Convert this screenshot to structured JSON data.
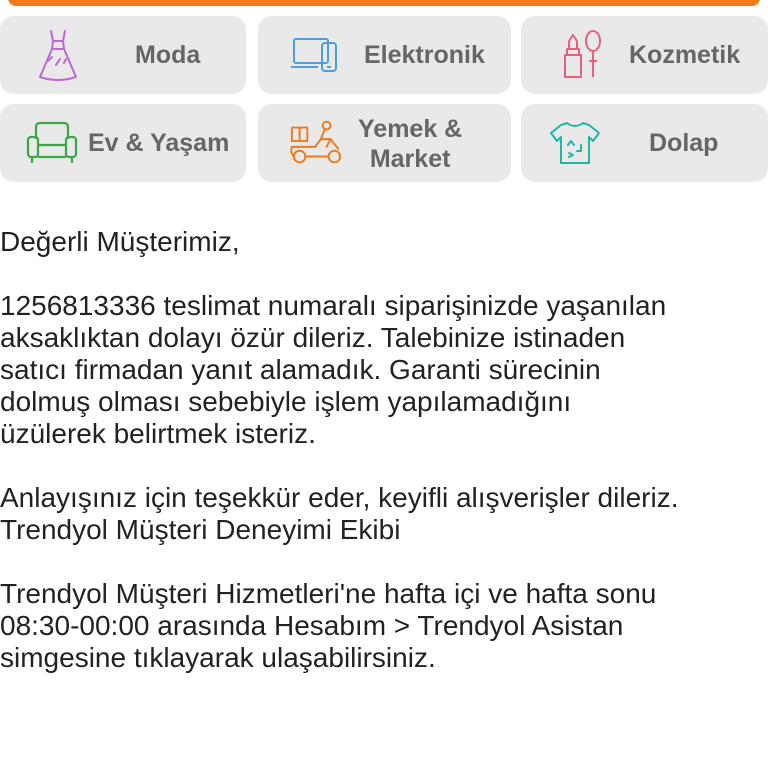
{
  "colors": {
    "accent": "#f27a1a",
    "tile_bg": "#e9e9e9",
    "label": "#666666"
  },
  "categories": [
    {
      "label": "Moda",
      "icon": "dress-icon",
      "color": "#c066d6"
    },
    {
      "label": "Elektronik",
      "icon": "devices-icon",
      "color": "#4a9fdc"
    },
    {
      "label": "Kozmetik",
      "icon": "lipstick-icon",
      "color": "#e8617a"
    },
    {
      "label": "Ev & Yaşam",
      "icon": "armchair-icon",
      "color": "#39a845"
    },
    {
      "label": "Yemek &\nMarket",
      "icon": "delivery-scooter-icon",
      "color": "#f27a1a"
    },
    {
      "label": "Dolap",
      "icon": "recycle-shirt-icon",
      "color": "#22b6a8"
    }
  ],
  "message": {
    "greeting": "Değerli Müşterimiz,",
    "body": "1256813336 teslimat numaralı siparişinizde yaşanılan\naksaklıktan dolayı özür dileriz. Talebinize istinaden\nsatıcı firmadan yanıt alamadık. Garanti sürecinin\ndolmuş olması sebebiyle işlem yapılamadığını\nüzülerek belirtmek isteriz.",
    "thanks": "Anlayışınız için teşekkür eder, keyifli alışverişler dileriz.\nTrendyol Müşteri Deneyimi Ekibi",
    "contact": "Trendyol Müşteri Hizmetleri'ne hafta içi ve hafta sonu\n08:30-00:00 arasında Hesabım > Trendyol Asistan\nsimgesine tıklayarak ulaşabilirsiniz."
  }
}
